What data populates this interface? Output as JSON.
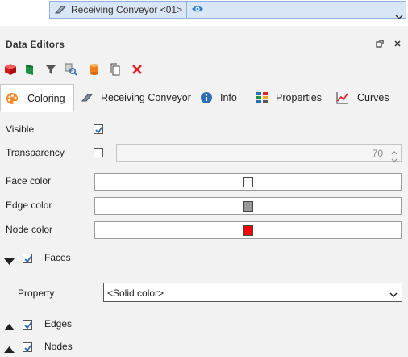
{
  "tree": {
    "object_name": "Receiving Conveyor <01>",
    "object_icon": "conveyor-object-icon",
    "visibility_icon": "eye-icon"
  },
  "panel": {
    "title": "Data Editors",
    "float_icon": "float-window-icon",
    "close_icon": "close-icon"
  },
  "toolbar": {
    "icons": [
      "red-cube-icon",
      "green-flag-icon",
      "filter-icon",
      "search-object-icon",
      "cylinder-icon",
      "copy-icon",
      "delete-icon"
    ]
  },
  "tabs": [
    {
      "label": "Coloring",
      "icon": "palette-icon",
      "active": true
    },
    {
      "label": "Receiving Conveyor",
      "icon": "conveyor-icon",
      "active": false
    },
    {
      "label": "Info",
      "icon": "info-icon",
      "active": false
    },
    {
      "label": "Properties",
      "icon": "properties-icon",
      "active": false
    },
    {
      "label": "Curves",
      "icon": "curves-icon",
      "active": false
    }
  ],
  "coloring": {
    "visible_label": "Visible",
    "visible_checked": true,
    "transparency_label": "Transparency",
    "transparency_checked": false,
    "transparency_value": "70",
    "face_color_label": "Face color",
    "face_color": "#ffffff",
    "edge_color_label": "Edge color",
    "edge_color": "#999999",
    "node_color_label": "Node color",
    "node_color": "#ff0000",
    "faces_label": "Faces",
    "faces_checked": true,
    "faces_expanded": true,
    "property_label": "Property",
    "property_value": "<Solid color>",
    "edges_label": "Edges",
    "edges_checked": true,
    "edges_expanded": false,
    "nodes_label": "Nodes",
    "nodes_checked": true,
    "nodes_expanded": false
  },
  "colors": {
    "accent": "#2f6db5",
    "tree_selection": "#d9e6f5"
  }
}
